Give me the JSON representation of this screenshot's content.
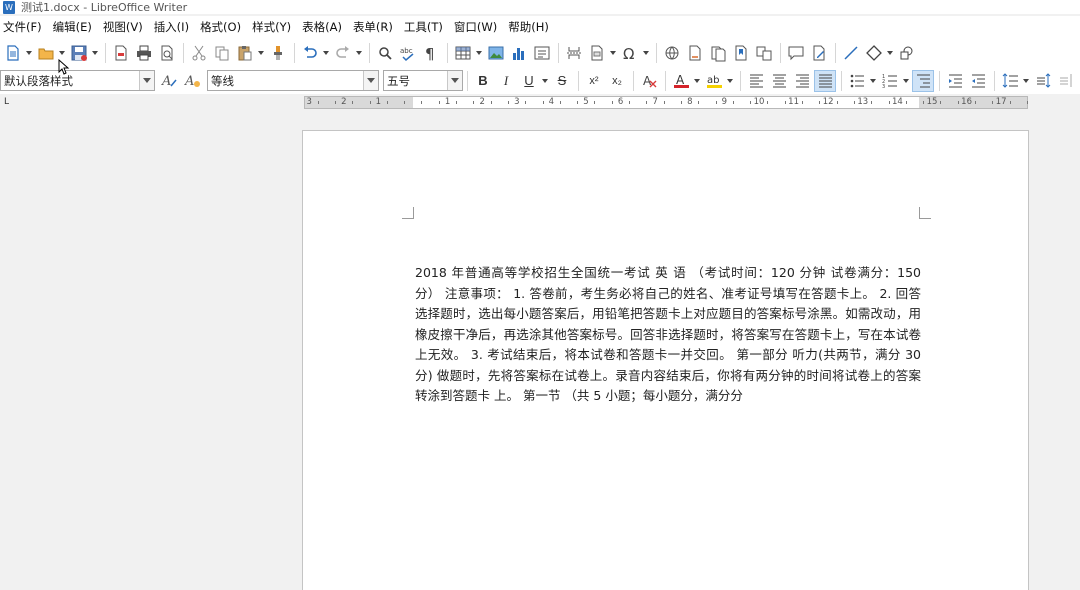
{
  "window": {
    "title": "测试1.docx - LibreOffice Writer",
    "app_icon_letter": "W"
  },
  "menu": {
    "items": [
      "文件(F)",
      "编辑(E)",
      "视图(V)",
      "插入(I)",
      "格式(O)",
      "样式(Y)",
      "表格(A)",
      "表单(R)",
      "工具(T)",
      "窗口(W)",
      "帮助(H)"
    ]
  },
  "toolbar_icons": {
    "standard": [
      "new-icon",
      "open-icon",
      "save-icon",
      "export-pdf-icon",
      "print-icon",
      "print-preview-icon",
      "cut-icon",
      "copy-icon",
      "paste-icon",
      "clone-format-icon",
      "undo-icon",
      "redo-icon",
      "find-replace-icon",
      "spellcheck-icon",
      "formatting-marks-icon",
      "insert-table-icon",
      "insert-image-icon",
      "insert-chart-icon",
      "insert-textbox-icon",
      "page-break-icon",
      "insert-field-icon",
      "special-character-icon",
      "hyperlink-icon",
      "footnote-icon",
      "endnote-icon",
      "bookmark-icon",
      "cross-reference-icon",
      "comment-icon",
      "track-changes-icon",
      "line-icon",
      "basic-shapes-icon",
      "draw-functions-icon"
    ],
    "formatting": [
      "bold-icon",
      "italic-icon",
      "underline-icon",
      "strikethrough-icon",
      "superscript-icon",
      "subscript-icon",
      "clear-formatting-icon",
      "font-color-icon",
      "highlight-icon",
      "align-left-icon",
      "align-center-icon",
      "align-right-icon",
      "justify-icon",
      "bullets-icon",
      "numbering-icon",
      "outline-icon",
      "increase-indent-icon",
      "decrease-indent-icon",
      "line-spacing-icon",
      "paragraph-spacing-increase-icon",
      "paragraph-spacing-decrease-icon"
    ]
  },
  "formatting": {
    "paragraph_style": "默认段落样式",
    "font_name": "等线",
    "font_size": "五号",
    "bold_label": "B",
    "italic_label": "I",
    "underline_label": "U",
    "strike_label": "S",
    "superscript_label": "x²",
    "subscript_label": "x₂",
    "font_color": "#d4232a",
    "highlight_color": "#f5d100",
    "active_alignment": "justify"
  },
  "ruler": {
    "labels": [
      "3",
      "2",
      "1",
      "1",
      "2",
      "3",
      "4",
      "5",
      "6",
      "7",
      "8",
      "9",
      "10",
      "11",
      "12",
      "13",
      "14",
      "15",
      "16",
      "17"
    ],
    "tab_stop_symbol": "L"
  },
  "document": {
    "body": "2018 年普通高等学校招生全国统一考试 英 语 （考试时间：120 分钟 试卷满分：150 分） 注意事项： 1. 答卷前，考生务必将自己的姓名、准考证号填写在答题卡上。 2. 回答选择题时，选出每小题答案后，用铅笔把答题卡上对应题目的答案标号涂黑。如需改动，用橡皮擦干净后，再选涂其他答案标号。回答非选择题时，将答案写在答题卡上，写在本试卷上无效。 3. 考试结束后，将本试卷和答题卡一并交回。 第一部分 听力(共两节，满分 30 分) 做题时，先将答案标在试卷上。录音内容结束后，你将有两分钟的时间将试卷上的答案转涂到答题卡 上。 第一节 （共 5 小题；每小题分，满分分"
  }
}
